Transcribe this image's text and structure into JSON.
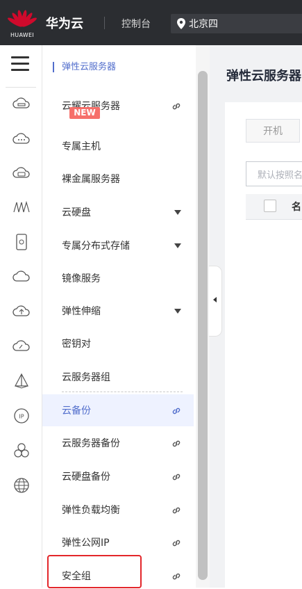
{
  "header": {
    "logo_text": "HUAWEI",
    "brand": "华为云",
    "console": "控制台",
    "region": "北京四"
  },
  "icon_rail": {
    "icons": [
      "menu-icon",
      "cloud-server-icon",
      "cloud-dots-icon",
      "cloud-disk-icon",
      "network-wave-icon",
      "phone-device-icon",
      "cloud-outline-icon",
      "cloud-upload-icon",
      "cloud-gauge-icon",
      "tent-icon",
      "ip-icon",
      "hexagon-cluster-icon",
      "globe-w-icon"
    ]
  },
  "menu": {
    "top_label": "弹性云服务器",
    "items": [
      {
        "label": "云耀云服务器",
        "link": true,
        "badge": "NEW"
      },
      {
        "label": "专属主机"
      },
      {
        "label": "裸金属服务器"
      },
      {
        "label": "云硬盘",
        "caret": true
      },
      {
        "label": "专属分布式存储",
        "caret": true
      },
      {
        "label": "镜像服务"
      },
      {
        "label": "弹性伸缩",
        "caret": true
      },
      {
        "label": "密钥对"
      },
      {
        "label": "云服务器组"
      },
      {
        "label": "云备份",
        "link": true,
        "active": true
      },
      {
        "label": "云服务器备份",
        "link": true
      },
      {
        "label": "云硬盘备份",
        "link": true
      },
      {
        "label": "弹性负载均衡",
        "link": true
      },
      {
        "label": "弹性公网IP",
        "link": true
      },
      {
        "label": "安全组",
        "link": true,
        "highlighted": true
      }
    ]
  },
  "main": {
    "title": "弹性云服务器",
    "start_button": "开机",
    "search_placeholder": "默认按照名",
    "table_first_col": "名"
  },
  "colors": {
    "header_bg": "#2b2d31",
    "accent": "#526ecc",
    "badge": "#f66f6a",
    "highlight": "#e3262a"
  }
}
